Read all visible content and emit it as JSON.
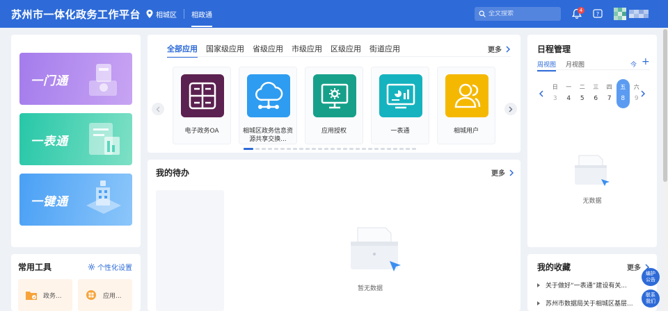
{
  "header": {
    "title": "苏州市一体化政务工作平台",
    "location": "相城区",
    "tab": "相政通",
    "search_placeholder": "全文搜索",
    "notification_count": "4",
    "icons": {
      "location": "map-pin-icon",
      "search": "search-icon",
      "bell": "bell-icon",
      "help": "help-icon"
    },
    "accent_color": "#2e6bd8"
  },
  "promos": [
    {
      "label": "一门通",
      "color": "#a47cec"
    },
    {
      "label": "一表通",
      "color": "#27c7a8"
    },
    {
      "label": "一键通",
      "color": "#4aa0f5"
    }
  ],
  "tools": {
    "title": "常用工具",
    "settings_label": "个性化设置",
    "items": [
      {
        "label": "政务..."
      },
      {
        "label": "应用..."
      }
    ]
  },
  "apps": {
    "tabs": [
      "全部应用",
      "国家级应用",
      "省级应用",
      "市级应用",
      "区级应用",
      "街道应用"
    ],
    "active_tab": 0,
    "more_label": "更多",
    "items": [
      {
        "name": "电子政务OA",
        "color": "#5b2150",
        "icon": "oa-logo-icon"
      },
      {
        "name": "相城区政务信息资源共享交换...",
        "color": "#2e9cf0",
        "icon": "cloud-share-icon"
      },
      {
        "name": "应用授权",
        "color": "#16a08a",
        "icon": "monitor-gear-icon"
      },
      {
        "name": "一表通",
        "color": "#15b3bf",
        "icon": "dashboard-icon"
      },
      {
        "name": "相城用户",
        "color": "#f5b800",
        "icon": "users-icon"
      }
    ]
  },
  "todo": {
    "title": "我的待办",
    "more_label": "更多",
    "empty_text": "暂无数据"
  },
  "schedule": {
    "title": "日程管理",
    "tabs": [
      "周视图",
      "月视图"
    ],
    "today_label": "今",
    "add_label": "+",
    "weekdays": [
      "日",
      "一",
      "二",
      "三",
      "四",
      "五",
      "六"
    ],
    "dates": [
      "3",
      "4",
      "5",
      "6",
      "7",
      "8",
      "9"
    ],
    "selected_index": 5,
    "empty_text": "无数据"
  },
  "favorites": {
    "title": "我的收藏",
    "more_label": "更多",
    "items": [
      "关于做好“一表通”建设有关...",
      "苏州市数据局关于相城区基层..."
    ]
  },
  "float_buttons": [
    {
      "line1": "编护",
      "line2": "公告"
    },
    {
      "line1": "联系",
      "line2": "我们"
    }
  ]
}
